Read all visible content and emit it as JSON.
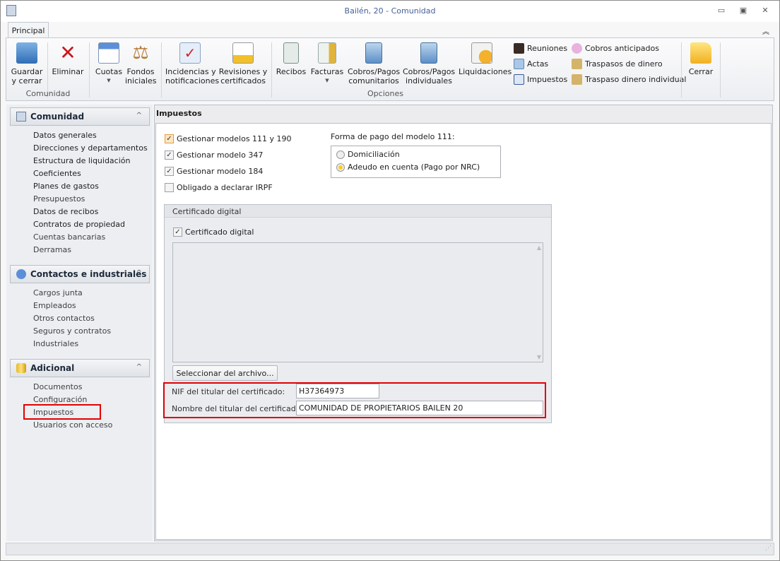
{
  "window": {
    "title": "Bailén, 20 - Comunidad"
  },
  "ribbon": {
    "tab": "Principal",
    "groups": {
      "comunidad": "Comunidad",
      "opciones": "Opciones"
    },
    "buttons": {
      "guardar": "Guardar\ny cerrar",
      "eliminar": "Eliminar",
      "cuotas": "Cuotas",
      "fondos": "Fondos\niniciales",
      "incidencias": "Incidencias y\nnotificaciones",
      "revisiones": "Revisiones y\ncertificados",
      "recibos": "Recibos",
      "facturas": "Facturas",
      "cobros_com": "Cobros/Pagos\ncomunitarios",
      "cobros_ind": "Cobros/Pagos\nindividuales",
      "liquidaciones": "Liquidaciones",
      "reuniones": "Reuniones",
      "actas": "Actas",
      "impuestos": "Impuestos",
      "cobros_anticipados": "Cobros anticipados",
      "traspasos": "Traspasos de dinero",
      "traspaso_ind": "Traspaso dinero individual",
      "cerrar": "Cerrar"
    }
  },
  "sidebar": {
    "sections": [
      {
        "title": "Comunidad",
        "items": [
          "Datos generales",
          "Direcciones y departamentos",
          "Estructura de liquidación",
          "Coeficientes",
          "Planes de gastos",
          "Presupuestos",
          "Datos de recibos",
          "Contratos de propiedad",
          "Cuentas bancarias",
          "Derramas"
        ]
      },
      {
        "title": "Contactos e industriales",
        "items": [
          "Cargos junta",
          "Empleados",
          "Otros contactos",
          "Seguros y contratos",
          "Industriales"
        ]
      },
      {
        "title": "Adicional",
        "items": [
          "Documentos",
          "Configuración",
          "Impuestos",
          "Usuarios con acceso"
        ]
      }
    ],
    "selected": "Impuestos"
  },
  "main": {
    "title": "Impuestos",
    "checks": [
      {
        "label": "Gestionar modelos 111 y 190",
        "checked": true
      },
      {
        "label": "Gestionar modelo 347",
        "checked": true
      },
      {
        "label": "Gestionar modelo 184",
        "checked": true
      },
      {
        "label": "Obligado a declarar IRPF",
        "checked": false
      }
    ],
    "payment": {
      "label": "Forma de pago del modelo 111:",
      "options": [
        "Domiciliación",
        "Adeudo en cuenta (Pago por NRC)"
      ],
      "selected": 1
    },
    "cert": {
      "group_title": "Certificado digital",
      "check_label": "Certificado digital",
      "checked": true,
      "select_button": "Seleccionar del archivo...",
      "nif_label": "NIF del titular del certificado:",
      "nif_value": "H37364973",
      "name_label": "Nombre del titular del certificado:",
      "name_value": "COMUNIDAD DE PROPIETARIOS BAILEN 20"
    }
  },
  "colors": {
    "highlight": "#e00000",
    "accent": "#e39a3b"
  }
}
